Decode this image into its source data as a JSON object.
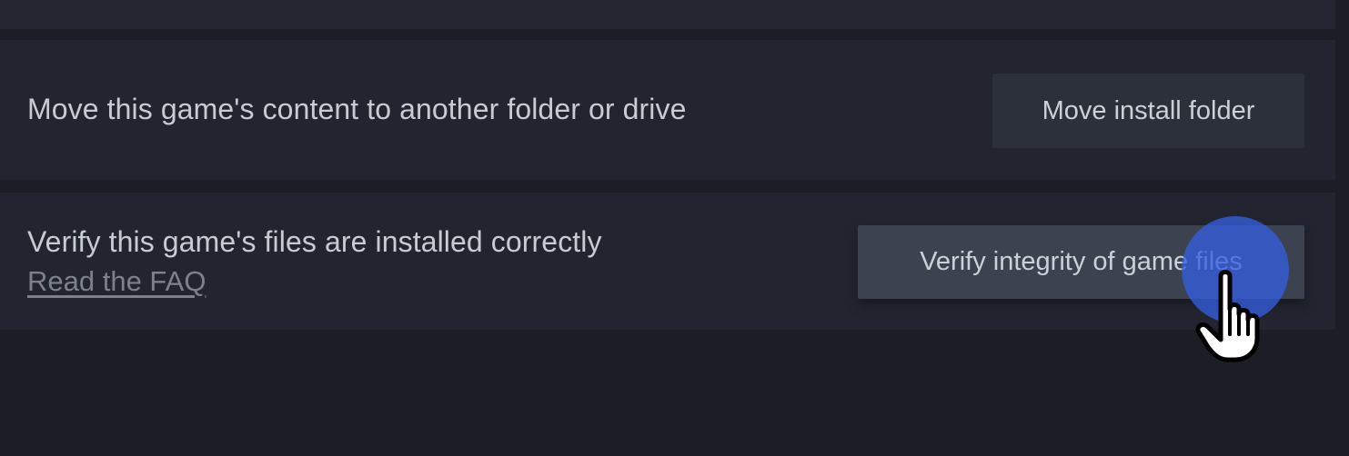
{
  "move_section": {
    "description": "Move this game's content to another folder or drive",
    "button_label": "Move install folder"
  },
  "verify_section": {
    "description": "Verify this game's files are installed correctly",
    "faq_link": "Read the FAQ",
    "button_label": "Verify integrity of game files"
  },
  "cursor": {
    "icon": "hand-pointer-icon",
    "click_highlight_color": "#345edc"
  },
  "colors": {
    "background": "#1b1e25",
    "panel": "#222530",
    "text": "#c7cbd2",
    "link": "#7c818a",
    "button_default": "#2c303a",
    "button_hover": "#3c4250"
  }
}
